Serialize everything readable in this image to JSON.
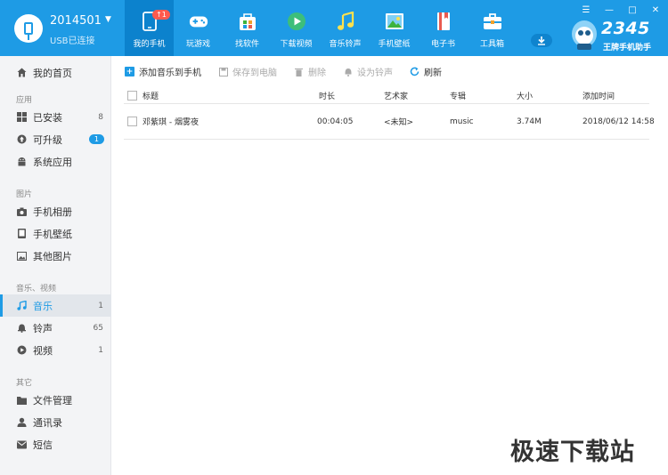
{
  "device": {
    "name": "2014501",
    "status": "USB已连接"
  },
  "window_controls": [
    "☰",
    "—",
    "□",
    "✕"
  ],
  "topnav": [
    {
      "label": "我的手机",
      "icon": "phone-icon",
      "badge": "↑1"
    },
    {
      "label": "玩游戏",
      "icon": "gamepad-icon"
    },
    {
      "label": "找软件",
      "icon": "app-store-icon"
    },
    {
      "label": "下载视频",
      "icon": "play-icon"
    },
    {
      "label": "音乐铃声",
      "icon": "music-note-icon"
    },
    {
      "label": "手机壁纸",
      "icon": "picture-icon"
    },
    {
      "label": "电子书",
      "icon": "book-icon"
    },
    {
      "label": "工具箱",
      "icon": "toolbox-icon"
    }
  ],
  "brand": {
    "number": "2345",
    "subtitle": "王牌手机助手"
  },
  "sidebar": {
    "home": {
      "label": "我的首页"
    },
    "sections": [
      {
        "title": "应用",
        "items": [
          {
            "label": "已安装",
            "count": "8"
          },
          {
            "label": "可升级",
            "badge": "1"
          },
          {
            "label": "系统应用"
          }
        ]
      },
      {
        "title": "图片",
        "items": [
          {
            "label": "手机相册"
          },
          {
            "label": "手机壁纸"
          },
          {
            "label": "其他图片"
          }
        ]
      },
      {
        "title": "音乐、视频",
        "items": [
          {
            "label": "音乐",
            "count": "1",
            "active": true
          },
          {
            "label": "铃声",
            "count": "65"
          },
          {
            "label": "视频",
            "count": "1"
          }
        ]
      },
      {
        "title": "其它",
        "items": [
          {
            "label": "文件管理"
          },
          {
            "label": "通讯录"
          },
          {
            "label": "短信"
          }
        ]
      }
    ]
  },
  "toolbar": {
    "add_label": "添加音乐到手机",
    "save_label": "保存到电脑",
    "delete_label": "删除",
    "ringtone_label": "设为铃声",
    "refresh_label": "刷新"
  },
  "table": {
    "headers": {
      "title": "标题",
      "duration": "时长",
      "artist": "艺术家",
      "album": "专辑",
      "size": "大小",
      "added": "添加时间"
    },
    "rows": [
      {
        "title": "邓紫琪 - 烟雾夜",
        "duration": "00:04:05",
        "artist": "<未知>",
        "album": "music",
        "size": "3.74M",
        "added": "2018/06/12 14:58"
      }
    ]
  },
  "watermark": "极速下载站",
  "colors": {
    "accent": "#1e9be5",
    "header_active": "#0c82cd",
    "sidebar_bg": "#f3f4f6"
  }
}
